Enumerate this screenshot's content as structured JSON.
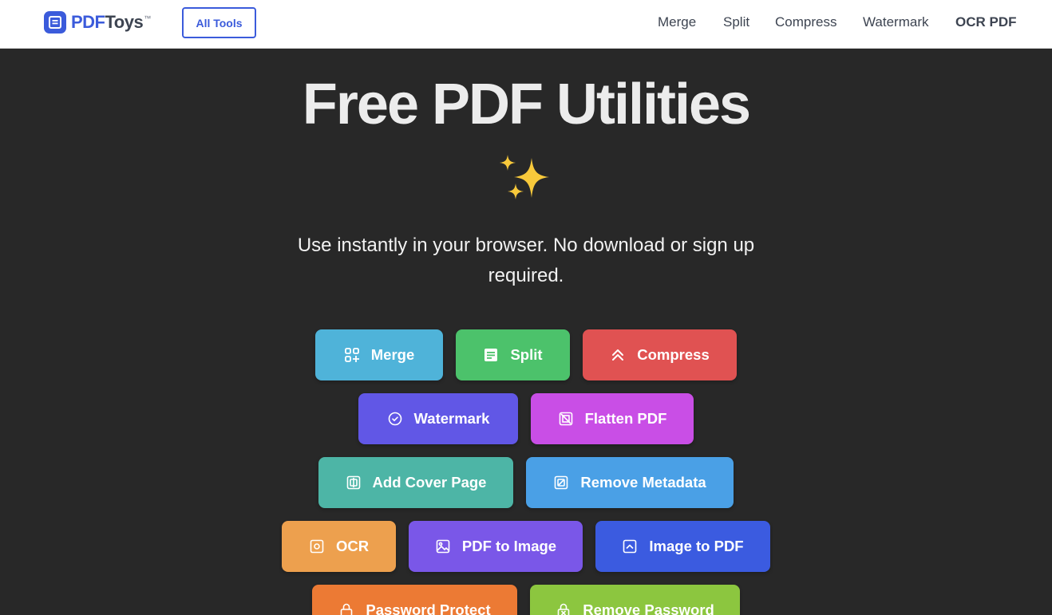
{
  "brand": {
    "name_part1": "PDF",
    "name_part2": "Toys",
    "trademark": "™",
    "color": "#3b5bdb"
  },
  "header": {
    "all_tools_label": "All Tools",
    "nav": [
      {
        "label": "Merge"
      },
      {
        "label": "Split"
      },
      {
        "label": "Compress"
      },
      {
        "label": "Watermark"
      },
      {
        "label": "OCR PDF"
      }
    ]
  },
  "hero": {
    "title": "Free PDF Utilities",
    "emoji": "sparkles",
    "subtitle": "Use instantly in your browser. No download or sign up required."
  },
  "tools": [
    {
      "label": "Merge",
      "icon": "grid-plus-icon",
      "color": "#4fb3d9"
    },
    {
      "label": "Split",
      "icon": "split-doc-icon",
      "color": "#4cc26b"
    },
    {
      "label": "Compress",
      "icon": "double-chevron-up-icon",
      "color": "#e05252"
    },
    {
      "label": "Watermark",
      "icon": "check-circle-icon",
      "color": "#6157e6"
    },
    {
      "label": "Flatten PDF",
      "icon": "flatten-icon",
      "color": "#c94ee6"
    },
    {
      "label": "Add Cover Page",
      "icon": "cover-page-icon",
      "color": "#4db5a6"
    },
    {
      "label": "Remove Metadata",
      "icon": "remove-metadata-icon",
      "color": "#4aa0e6"
    },
    {
      "label": "OCR",
      "icon": "ocr-icon",
      "color": "#eda04e"
    },
    {
      "label": "PDF to Image",
      "icon": "image-icon",
      "color": "#7a57e8"
    },
    {
      "label": "Image to PDF",
      "icon": "image-to-pdf-icon",
      "color": "#3b5be0"
    },
    {
      "label": "Password Protect",
      "icon": "lock-icon",
      "color": "#ec7a34"
    },
    {
      "label": "Remove Password",
      "icon": "unlock-icon",
      "color": "#8cc63f"
    }
  ]
}
